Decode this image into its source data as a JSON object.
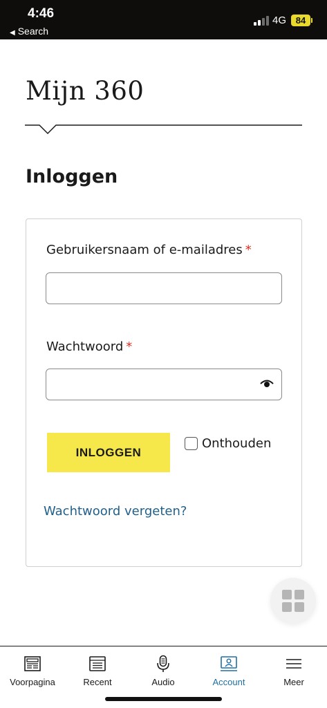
{
  "status": {
    "time": "4:46",
    "back_label": "Search",
    "network": "4G",
    "battery": "84"
  },
  "header": {
    "brand": "Mijn 360"
  },
  "page": {
    "heading": "Inloggen"
  },
  "form": {
    "username_label": "Gebruikersnaam of e-mailadres",
    "username_value": "",
    "password_label": "Wachtwoord",
    "password_value": "",
    "required_mark": "*",
    "login_button": "INLOGGEN",
    "remember_label": "Onthouden",
    "remember_checked": false,
    "forgot_link": "Wachtwoord vergeten?"
  },
  "tabbar": {
    "items": [
      {
        "label": "Voorpagina",
        "icon": "newspaper-icon",
        "active": false
      },
      {
        "label": "Recent",
        "icon": "list-window-icon",
        "active": false
      },
      {
        "label": "Audio",
        "icon": "microphone-icon",
        "active": false
      },
      {
        "label": "Account",
        "icon": "account-monitor-icon",
        "active": true
      },
      {
        "label": "Meer",
        "icon": "hamburger-menu-icon",
        "active": false
      }
    ]
  },
  "colors": {
    "accent_button": "#f6e84a",
    "link": "#1f5f8b",
    "active_tab": "#1f6fa3",
    "required": "#d93025",
    "status_bar": "#0f0d0c"
  }
}
